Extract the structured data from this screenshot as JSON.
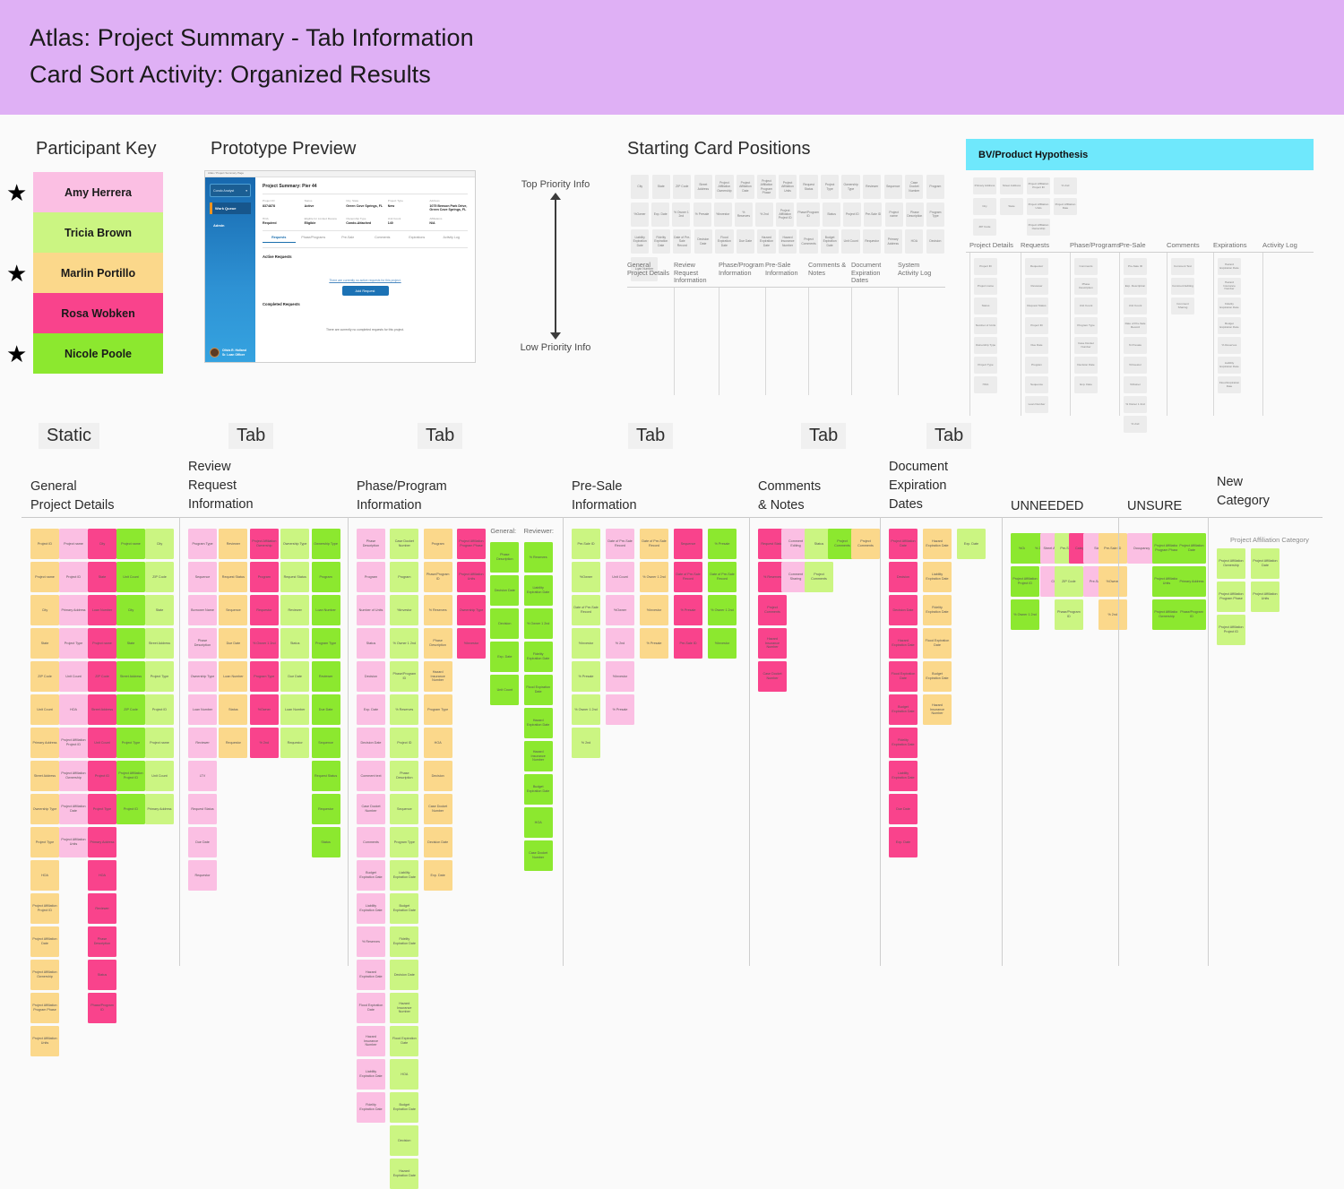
{
  "header": {
    "line1": "Atlas: Project Summary - Tab Information",
    "line2": "Card Sort Activity: Organized Results",
    "bg": "#DFB0F5"
  },
  "participant_key": {
    "title": "Participant Key",
    "star_glyph": "★",
    "participants": [
      {
        "name": "Amy Herrera",
        "color": "#FBBFE3",
        "starred": true
      },
      {
        "name": "Tricia Brown",
        "color": "#CBF582",
        "starred": false
      },
      {
        "name": "Marlin Portillo",
        "color": "#FBD88B",
        "starred": true
      },
      {
        "name": "Rosa Wobken",
        "color": "#F9438C",
        "starred": false
      },
      {
        "name": "Nicole Poole",
        "color": "#8CE82F",
        "starred": true
      }
    ]
  },
  "prototype": {
    "title": "Prototype Preview",
    "browser_crumb": "Atlas / Project Summary Page",
    "sidebar": {
      "role_selector": "Condo Analyst",
      "items": [
        "Work Queue",
        "Admin"
      ],
      "user_name": "Olivia R. Holland",
      "user_role": "Sr. Loan Officer"
    },
    "page_title": "Project Summary: Pier 44",
    "fields_row1": [
      {
        "label": "Project ID",
        "value": "8374878"
      },
      {
        "label": "Status",
        "value": "Active"
      },
      {
        "label": "City, State",
        "value": "Green Cove Springs, FL"
      },
      {
        "label": "Project Type",
        "value": "New"
      },
      {
        "label": "Address",
        "value": "1075 Benson Park Drive, Green Cove Springs, FL"
      }
    ],
    "fields_row2": [
      {
        "label": "HOA",
        "value": "Required"
      },
      {
        "label": "Eligible for Limited Review",
        "value": "Eligible"
      },
      {
        "label": "Ownership Type",
        "value": "Condo-Attached"
      },
      {
        "label": "Unit Count",
        "value": "140"
      },
      {
        "label": "Affiliations",
        "value": "N/A"
      }
    ],
    "tabs": [
      "Requests",
      "Phase/Programs",
      "Pre-Sale",
      "Comments",
      "Expirations",
      "Activity Log"
    ],
    "active_tab": "Requests",
    "active_section": "Active Requests",
    "active_empty": "There are currently no active requests for this project.",
    "add_button": "Add Request",
    "completed_section": "Completed Requests",
    "completed_empty": "There are currently no completed requests for this project."
  },
  "priority_scale": {
    "top_label": "Top Priority Info",
    "bottom_label": "Low Priority Info"
  },
  "starting_cards": {
    "title": "Starting Card Positions",
    "rows": [
      [
        "City",
        "State",
        "ZIP Code",
        "Street Address",
        "Project Affiliation Ownership",
        "Project Affiliation Date",
        "Project Affiliation Program Phase",
        "Project Affiliation Units",
        "Request Status",
        "Project Type",
        "Ownership Type",
        "Reviewer",
        "Sequence",
        "Case Docket Number",
        "Program"
      ],
      [
        "%Owner",
        "Exp. Date",
        "% Owner 1 2nd",
        "% Presale",
        "%Investor",
        "% Reserves",
        "% 2nd",
        "Project Affiliation Project ID",
        "Phase/Program ID",
        "Status",
        "Project ID",
        "Pre-Sale ID",
        "Project name",
        "Phase Description",
        "Program Type"
      ],
      [
        "Liability Expiration Date",
        "Fidelity Expiration Date",
        "Date of Pre-Sale Record",
        "Decision Date",
        "Flood Expiration Date",
        "Due Date",
        "Hazard Expiration Date",
        "Hazard Insurance Number",
        "Project Comments",
        "Budget Expiration Date",
        "Unit Count",
        "Requestor",
        "Primary Address",
        "HOA",
        "Decision"
      ],
      [
        "Loan Number"
      ]
    ],
    "columns": [
      "General Project Details",
      "Review Request Information",
      "Phase/Program Information",
      "Pre-Sale Information",
      "Comments & Notes",
      "Document Expiration Dates",
      "System Activity Log"
    ]
  },
  "bv_hypothesis": {
    "title": "BV/Product Hypothesis",
    "bar_color": "#6FE8FC",
    "loose_rows": [
      [
        "Primary Address",
        "Street Address",
        "Project Affiliation Project ID",
        "% 2nd"
      ],
      [
        "City",
        "State",
        "Project Affiliation Units",
        "Project Affiliation Date"
      ],
      [
        "ZIP Code",
        "",
        "Project Affiliation Ownership",
        ""
      ]
    ],
    "columns": [
      {
        "name": "Project Details",
        "cards": [
          "Project ID",
          "Project name",
          "Status",
          "Number of Units",
          "Ownership Type",
          "Project Type",
          "HOA"
        ]
      },
      {
        "name": "Requests",
        "cards": [
          "Requestor",
          "Reviewer",
          "Request Status",
          "Project ID",
          "Due Date",
          "Program",
          "Sequence",
          "Loan Number"
        ]
      },
      {
        "name": "Phase/Programs",
        "cards": [
          "Comments",
          "Phase Description",
          "Unit Count",
          "Program Type",
          "Case Docket Number",
          "Decision Date",
          "Exp. Date"
        ]
      },
      {
        "name": "Pre-Sale",
        "cards": [
          "Pre-Sale ID",
          "Exp. Description",
          "Unit Count",
          "Date of Pre-Sale Record",
          "% Presale",
          "%Investor",
          "%Owner",
          "% Owner 1 2nd",
          "% 2nd"
        ]
      },
      {
        "name": "Comments",
        "cards": [
          "Comment Text",
          "Comment Editing",
          "Comment Sharing"
        ]
      },
      {
        "name": "Expirations",
        "cards": [
          "Hazard Expiration Date",
          "Hazard Insurance Number",
          "Fidelity Expiration Date",
          "Budget Expiration Date",
          "% Reserves",
          "Liability Expiration Date",
          "Flood Expiration Date"
        ]
      },
      {
        "name": "Activity Log",
        "cards": []
      }
    ]
  },
  "board": {
    "columns": [
      {
        "tag": "Static",
        "name": "General\nProject Details",
        "name_line1": "General",
        "name_line2": "Project Details",
        "stacks": [
          {
            "color": "#FBD88B",
            "cards": [
              "Project ID",
              "Project name",
              "City",
              "State",
              "ZIP Code",
              "Unit Count",
              "Primary Address",
              "Street Address",
              "Ownership Type",
              "Project Type",
              "HOA",
              "Project Affiliation Project ID",
              "Project Affiliation Date",
              "Project Affiliation Ownership",
              "Project Affiliation Program Phase",
              "Project Affiliation Units"
            ]
          },
          {
            "color": "#FBBFE3",
            "cards": [
              "Project name",
              "Project ID",
              "Primary Address",
              "Project Type",
              "Unit Count",
              "HOA",
              "Project Affiliation Project ID",
              "Project Affiliation Ownership",
              "Project Affiliation Date",
              "Project Affiliation Units"
            ]
          },
          {
            "color": "#F9438C",
            "cards": [
              "City",
              "State",
              "Loan Number",
              "Project name",
              "ZIP Code",
              "Street Address",
              "Unit Count",
              "Project ID",
              "Project Type",
              "Primary Address",
              "HOA",
              "Reviewer",
              "Phase Description",
              "Status",
              "Phase/Program ID"
            ]
          },
          {
            "color": "#8CE82F",
            "cards": [
              "Project name",
              "Unit Count",
              "City",
              "State",
              "Street Address",
              "ZIP Code",
              "Project Type",
              "Project Affiliation Project ID",
              "Project ID"
            ]
          },
          {
            "color": "#CBF582",
            "cards": [
              "City",
              "ZIP Code",
              "State",
              "Street Address",
              "Project Type",
              "Project ID",
              "Project name",
              "Unit Count",
              "Primary Address"
            ]
          }
        ]
      },
      {
        "tag": "Tab",
        "name_line1": "Review",
        "name_line2": "Request",
        "name_line3": "Information",
        "stacks": [
          {
            "color": "#FBBFE3",
            "cards": [
              "Program Type",
              "Sequence",
              "Borrower Name",
              "Phase Description",
              "Ownership Type",
              "Loan Number",
              "Reviewer",
              "LTV",
              "Request Status",
              "Due Date",
              "Requestor"
            ]
          },
          {
            "color": "#FBD88B",
            "cards": [
              "Reviewer",
              "Request Status",
              "Sequence",
              "Due Date",
              "Loan Number",
              "Status",
              "Requestor"
            ]
          },
          {
            "color": "#F9438C",
            "cards": [
              "Project Affiliation Ownership",
              "Program",
              "Requestor",
              "% Owner 1 2nd",
              "Program Type",
              "%Owner",
              "% 2nd"
            ]
          },
          {
            "color": "#CBF582",
            "cards": [
              "Ownership Type",
              "Request Status",
              "Reviewer",
              "Status",
              "Due Date",
              "Loan Number",
              "Requestor"
            ]
          },
          {
            "color": "#8CE82F",
            "cards": [
              "Ownership Type",
              "Program",
              "Loan Number",
              "Program Type",
              "Reviewer",
              "Due Date",
              "Sequence",
              "Request Status",
              "Requestor",
              "Status"
            ]
          }
        ]
      },
      {
        "tag": "Tab",
        "name_line1": "Phase/Program",
        "name_line2": "Information",
        "sub_labels": [
          "General:",
          "Reviewer:"
        ],
        "stacks": [
          {
            "color": "#FBBFE3",
            "cards": [
              "Phase Description",
              "Program",
              "Number of Units",
              "Status",
              "Decision",
              "Exp. Date",
              "Decision Date",
              "Comment text",
              "Case Docket Number",
              "Comments",
              "Budget Expiration Date",
              "Liability Expiration Date",
              "% Reserves",
              "Hazard Expiration Date",
              "Flood Expiration Date",
              "Hazard Insurance Number",
              "Liability Expiration Date",
              "Fidelity Expiration Date"
            ]
          },
          {
            "color": "#CBF582",
            "cards": [
              "Case Docket Number",
              "Program",
              "%Investor",
              "% Owner 1 2nd",
              "Phase/Program ID",
              "% Reserves",
              "Project ID",
              "Phase Description",
              "Sequence",
              "Program Type",
              "Liability Expiration Date",
              "Budget Expiration Date",
              "Fidelity Expiration Date",
              "Decision Date",
              "Hazard Insurance Number",
              "Flood Expiration Date",
              "HOA",
              "Budget Expiration Date",
              "Decision",
              "Hazard Expiration Date"
            ]
          },
          {
            "color": "#FBD88B",
            "cards": [
              "Program",
              "Phase/Program ID",
              "% Reserves",
              "Phase Description",
              "Hazard Insurance Number",
              "Program Type",
              "HOA",
              "Decision",
              "Case Docket Number",
              "Decision Date",
              "Exp. Date"
            ]
          },
          {
            "color": "#F9438C",
            "cards": [
              "Project Affiliation Program Phase",
              "Project Affiliation Units",
              "Ownership Type",
              "%Investor"
            ]
          },
          {
            "color": "#8CE82F",
            "cards": [
              "Phase Description",
              "Decision Date",
              "Decision",
              "Exp. Date",
              "Unit Count"
            ],
            "label": "General:"
          },
          {
            "color": "#8CE82F",
            "cards": [
              "% Reserves",
              "Liability Expiration Date",
              "% Owner 1 2nd",
              "Fidelity Expiration Date",
              "Flood Expiration Date",
              "Hazard Expiration Date",
              "Hazard Insurance Number",
              "Budget Expiration Date",
              "HOA",
              "Case Docket Number"
            ],
            "label": "Reviewer:"
          }
        ]
      },
      {
        "tag": "Tab",
        "name_line1": "Pre-Sale",
        "name_line2": "Information",
        "stacks": [
          {
            "color": "#CBF582",
            "cards": [
              "Pre-Sale ID",
              "%Owner",
              "Date of Pre-Sale Record",
              "%Investor",
              "% Presale",
              "% Owner 1 2nd",
              "% 2nd"
            ]
          },
          {
            "color": "#FBBFE3",
            "cards": [
              "Date of Pre-Sale Record",
              "Unit Count",
              "%Owner",
              "% 2nd",
              "%Investor",
              "% Presale"
            ]
          },
          {
            "color": "#FBD88B",
            "cards": [
              "Date of Pre-Sale Record",
              "% Owner 1 2nd",
              "%Investor",
              "% Presale"
            ]
          },
          {
            "color": "#F9438C",
            "cards": [
              "Sequence",
              "Date of Pre-Sale Record",
              "% Presale",
              "Pre-Sale ID"
            ]
          },
          {
            "color": "#8CE82F",
            "cards": [
              "% Presale",
              "Date of Pre-Sale Record",
              "% Owner 1 2nd",
              "%Investor"
            ]
          }
        ]
      },
      {
        "tag": "Tab",
        "name_line1": "Comments",
        "name_line2": "& Notes",
        "stacks": [
          {
            "color": "#F9438C",
            "cards": [
              "Request Status",
              "% Reserves",
              "Project Comments",
              "Hazard Insurance Number",
              "Case Docket Number"
            ]
          },
          {
            "color": "#FBBFE3",
            "cards": [
              "Comment Editing",
              "Comment Sharing"
            ]
          },
          {
            "color": "#CBF582",
            "cards": [
              "Status",
              "Project Comments"
            ]
          },
          {
            "color": "#8CE82F",
            "cards": [
              "Project Comments"
            ]
          },
          {
            "color": "#FBD88B",
            "cards": [
              "Project Comments"
            ]
          }
        ]
      },
      {
        "tag": "Tab",
        "name_line1": "Document",
        "name_line2": "Expiration",
        "name_line3": "Dates",
        "stacks": [
          {
            "color": "#F9438C",
            "cards": [
              "Project Affiliation Date",
              "Decision",
              "Decision Date",
              "Hazard Expiration Date",
              "Flood Expiration Date",
              "Budget Expiration Date",
              "Fidelity Expiration Date",
              "Liability Expiration Date",
              "Due Date",
              "Exp. Date"
            ]
          },
          {
            "color": "#FBD88B",
            "cards": [
              "Hazard Expiration Date",
              "Liability Expiration Date",
              "Fidelity Expiration Date",
              "Flood Expiration Date",
              "Budget Expiration Date",
              "Hazard Insurance Number"
            ]
          },
          {
            "color": "#CBF582",
            "cards": [
              "Exp. Date"
            ]
          }
        ]
      },
      {
        "tag": "",
        "name_line1": "UNNEEDED",
        "stacks": [
          {
            "color": "#8CE82F",
            "cards": [
              "%Owner",
              "Project Affiliation Project ID",
              "% Owner 1 2nd"
            ]
          },
          {
            "color": "#8CE82F",
            "cards": [
              "% 2nd"
            ]
          },
          {
            "color": "#FBBFE3",
            "cards": [
              "Street Address",
              "City"
            ]
          },
          {
            "color": "#CBF582",
            "cards": [
              "Pre-Sale ID",
              "ZIP Code",
              "Phase/Program ID"
            ]
          },
          {
            "color": "#F9438C",
            "cards": [
              "Category A"
            ]
          },
          {
            "color": "#FBBFE3",
            "cards": [
              "State",
              "Pre-Sale ID"
            ]
          },
          {
            "color": "#FBD88B",
            "cards": [
              "Pre-Sale ID",
              "%Owner",
              "% 2nd"
            ]
          }
        ]
      },
      {
        "tag": "",
        "name_line1": "UNSURE",
        "stacks": [
          {
            "color": "#FBBFE3",
            "cards": [
              "Occupancy"
            ]
          },
          {
            "color": "#8CE82F",
            "cards": [
              "Project Affiliation Program Phase",
              "Project Affiliation Units",
              "Project Affiliation Ownership"
            ]
          },
          {
            "color": "#8CE82F",
            "cards": [
              "Project Affiliation Date",
              "Primary Address",
              "Phase/Program ID"
            ]
          }
        ]
      },
      {
        "tag": "",
        "name_line1": "New",
        "name_line2": "Category",
        "category_title": "Project Affiliation Category",
        "stacks": [
          {
            "color": "#CBF582",
            "cards": [
              "Project Affiliation Ownership",
              "Project Affiliation Program Phase",
              "Project Affiliation Project ID"
            ]
          },
          {
            "color": "#CBF582",
            "cards": [
              "Project Affiliation Date",
              "Project Affiliation Units"
            ]
          }
        ]
      }
    ]
  }
}
